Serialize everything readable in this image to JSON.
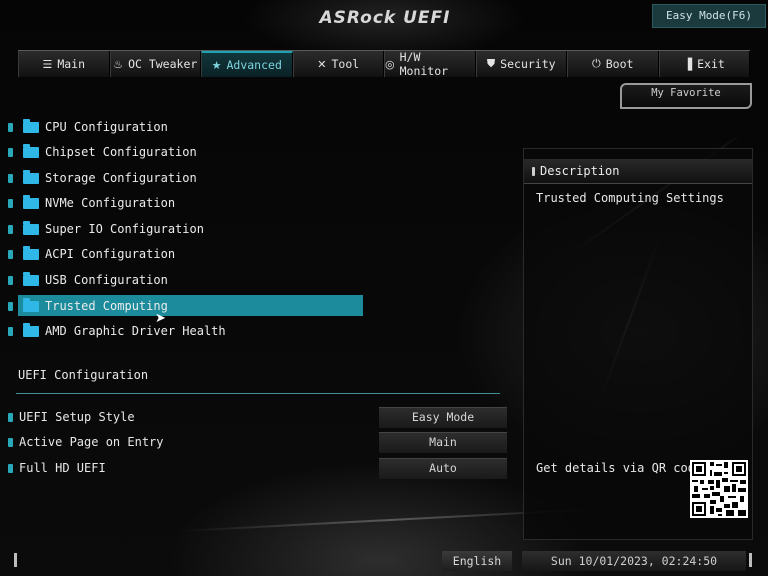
{
  "header": {
    "logo": "ASRock UEFI",
    "easy_mode_button": "Easy Mode(F6)"
  },
  "tabs": [
    {
      "label": "Main",
      "icon": "list-icon"
    },
    {
      "label": "OC Tweaker",
      "icon": "flame-icon"
    },
    {
      "label": "Advanced",
      "icon": "star-icon"
    },
    {
      "label": "Tool",
      "icon": "tools-icon"
    },
    {
      "label": "H/W Monitor",
      "icon": "monitor-icon"
    },
    {
      "label": "Security",
      "icon": "shield-icon"
    },
    {
      "label": "Boot",
      "icon": "power-icon"
    },
    {
      "label": "Exit",
      "icon": "exit-icon"
    }
  ],
  "active_tab": "Advanced",
  "favorite": {
    "label": "My Favorite"
  },
  "menu": {
    "items": [
      {
        "label": "CPU Configuration"
      },
      {
        "label": "Chipset Configuration"
      },
      {
        "label": "Storage Configuration"
      },
      {
        "label": "NVMe Configuration"
      },
      {
        "label": "Super IO Configuration"
      },
      {
        "label": "ACPI Configuration"
      },
      {
        "label": "USB Configuration"
      },
      {
        "label": "Trusted Computing"
      },
      {
        "label": "AMD Graphic Driver Health"
      }
    ],
    "selected": "Trusted Computing"
  },
  "uefi_section": {
    "title": "UEFI Configuration",
    "settings": [
      {
        "label": "UEFI Setup Style",
        "value": "Easy Mode"
      },
      {
        "label": "Active Page on Entry",
        "value": "Main"
      },
      {
        "label": "Full HD UEFI",
        "value": "Auto"
      }
    ]
  },
  "description": {
    "heading": "Description",
    "text": "Trusted Computing Settings",
    "qr_label": "Get details via QR code"
  },
  "footer": {
    "language": "English",
    "datetime": "Sun 10/01/2023, 02:24:50"
  },
  "colors": {
    "accent": "#1c8b9b",
    "active_tab_text": "#7fd4df",
    "folder": "#2fb7e8"
  }
}
